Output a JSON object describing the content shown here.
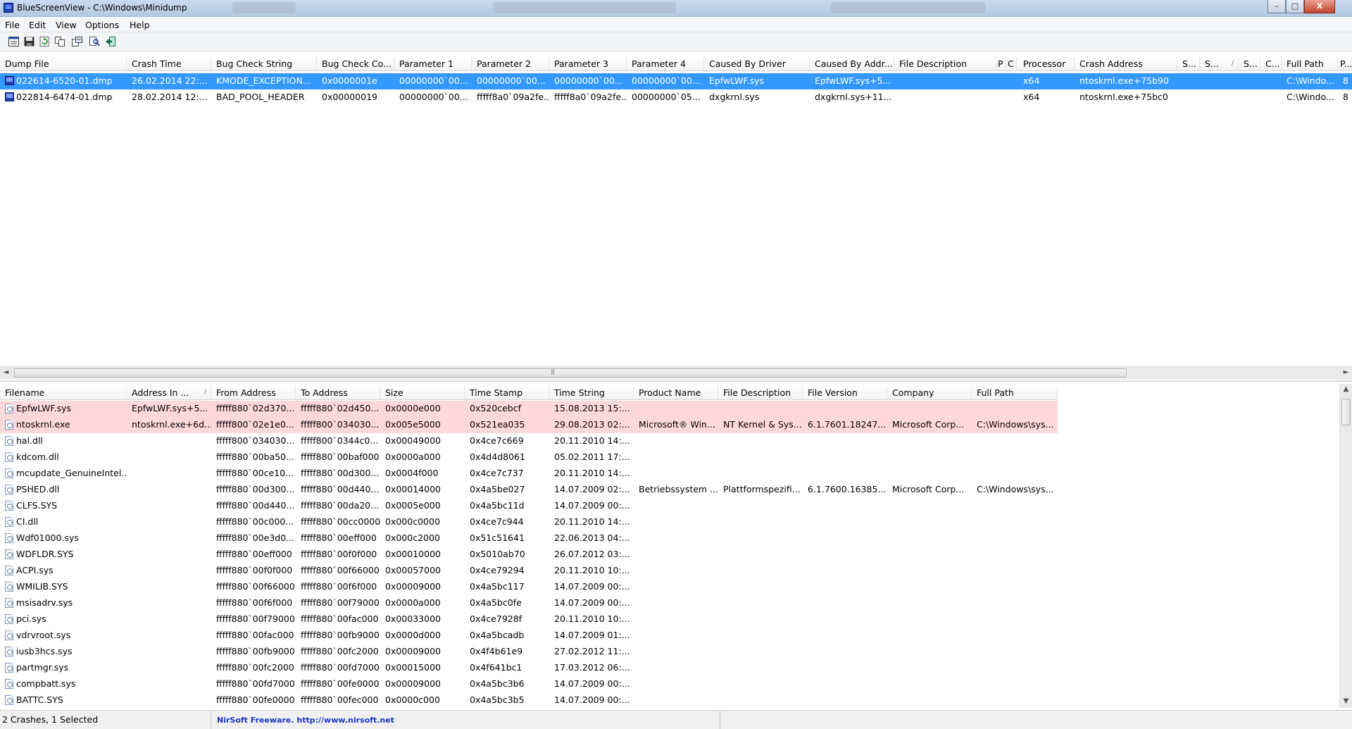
{
  "window": {
    "title": "BlueScreenView  -  C:\\Windows\\Minidump",
    "minimize": "–",
    "maximize": "□",
    "close": "X"
  },
  "menu": [
    "File",
    "Edit",
    "View",
    "Options",
    "Help"
  ],
  "toolbar": {
    "icons": [
      "properties-icon",
      "save-icon",
      "refresh-icon",
      "copy-icon",
      "advanced-options-icon",
      "find-icon",
      "exit-icon"
    ]
  },
  "crashes": {
    "columns": [
      "Dump File",
      "Crash Time",
      "Bug Check String",
      "Bug Check Co...",
      "Parameter 1",
      "Parameter 2",
      "Parameter 3",
      "Parameter 4",
      "Caused By Driver",
      "Caused By Addr...",
      "File Description",
      "P",
      "C",
      "Processor",
      "Crash Address",
      "S...",
      "S...",
      "S...",
      "C...",
      "Full Path",
      "P..."
    ],
    "rows": [
      {
        "selected": true,
        "cells": [
          "022614-6520-01.dmp",
          "26.02.2014 22:...",
          "KMODE_EXCEPTION...",
          "0x0000001e",
          "00000000`00...",
          "00000000`00...",
          "00000000`00...",
          "00000000`00...",
          "EpfwLWF.sys",
          "EpfwLWF.sys+5...",
          "",
          "",
          "",
          "x64",
          "ntoskrnl.exe+75b90",
          "",
          "",
          "",
          "",
          "C:\\Windo...",
          "8"
        ]
      },
      {
        "selected": false,
        "cells": [
          "022814-6474-01.dmp",
          "28.02.2014 12:...",
          "BAD_POOL_HEADER",
          "0x00000019",
          "00000000`00...",
          "fffff8a0`09a2fe...",
          "fffff8a0`09a2fe...",
          "00000000`05...",
          "dxgkrnl.sys",
          "dxgkrnl.sys+11...",
          "",
          "",
          "",
          "x64",
          "ntoskrnl.exe+75bc0",
          "",
          "",
          "",
          "",
          "C:\\Windo...",
          "8"
        ]
      }
    ]
  },
  "modules": {
    "columns": [
      "Filename",
      "Address In ...",
      "From Address",
      "To Address",
      "Size",
      "Time Stamp",
      "Time String",
      "Product Name",
      "File Description",
      "File Version",
      "Company",
      "Full Path"
    ],
    "sort_glyph": "/",
    "rows": [
      {
        "pink": true,
        "cells": [
          "EpfwLWF.sys",
          "EpfwLWF.sys+5...",
          "fffff880`02d370...",
          "fffff880`02d450...",
          "0x0000e000",
          "0x520cebcf",
          "15.08.2013 15:...",
          "",
          "",
          "",
          "",
          ""
        ]
      },
      {
        "pink": true,
        "cells": [
          "ntoskrnl.exe",
          "ntoskrnl.exe+6d...",
          "fffff800`02e1e0...",
          "fffff800`034030...",
          "0x005e5000",
          "0x521ea035",
          "29.08.2013 02:...",
          "Microsoft® Win...",
          "NT Kernel & Sys...",
          "6.1.7601.18247...",
          "Microsoft Corp...",
          "C:\\Windows\\sys..."
        ]
      },
      {
        "pink": false,
        "cells": [
          "hal.dll",
          "",
          "fffff800`034030...",
          "fffff800`0344c0...",
          "0x00049000",
          "0x4ce7c669",
          "20.11.2010 14:...",
          "",
          "",
          "",
          "",
          ""
        ]
      },
      {
        "pink": false,
        "cells": [
          "kdcom.dll",
          "",
          "fffff880`00ba50...",
          "fffff880`00baf000",
          "0x0000a000",
          "0x4d4d8061",
          "05.02.2011 17:...",
          "",
          "",
          "",
          "",
          ""
        ]
      },
      {
        "pink": false,
        "cells": [
          "mcupdate_GenuineIntel...",
          "",
          "fffff880`00ce10...",
          "fffff880`00d300...",
          "0x0004f000",
          "0x4ce7c737",
          "20.11.2010 14:...",
          "",
          "",
          "",
          "",
          ""
        ]
      },
      {
        "pink": false,
        "cells": [
          "PSHED.dll",
          "",
          "fffff880`00d300...",
          "fffff880`00d440...",
          "0x00014000",
          "0x4a5be027",
          "14.07.2009 02:...",
          "Betriebssystem ...",
          "Plattformspezifi...",
          "6.1.7600.16385...",
          "Microsoft Corp...",
          "C:\\Windows\\sys..."
        ]
      },
      {
        "pink": false,
        "cells": [
          "CLFS.SYS",
          "",
          "fffff880`00d440...",
          "fffff880`00da20...",
          "0x0005e000",
          "0x4a5bc11d",
          "14.07.2009 00:...",
          "",
          "",
          "",
          "",
          ""
        ]
      },
      {
        "pink": false,
        "cells": [
          "CI.dll",
          "",
          "fffff880`00c000...",
          "fffff880`00cc0000",
          "0x000c0000",
          "0x4ce7c944",
          "20.11.2010 14:...",
          "",
          "",
          "",
          "",
          ""
        ]
      },
      {
        "pink": false,
        "cells": [
          "Wdf01000.sys",
          "",
          "fffff880`00e3d0...",
          "fffff880`00eff000",
          "0x000c2000",
          "0x51c51641",
          "22.06.2013 04:...",
          "",
          "",
          "",
          "",
          ""
        ]
      },
      {
        "pink": false,
        "cells": [
          "WDFLDR.SYS",
          "",
          "fffff880`00eff000",
          "fffff880`00f0f000",
          "0x00010000",
          "0x5010ab70",
          "26.07.2012 03:...",
          "",
          "",
          "",
          "",
          ""
        ]
      },
      {
        "pink": false,
        "cells": [
          "ACPI.sys",
          "",
          "fffff880`00f0f000",
          "fffff880`00f66000",
          "0x00057000",
          "0x4ce79294",
          "20.11.2010 10:...",
          "",
          "",
          "",
          "",
          ""
        ]
      },
      {
        "pink": false,
        "cells": [
          "WMILIB.SYS",
          "",
          "fffff880`00f66000",
          "fffff880`00f6f000",
          "0x00009000",
          "0x4a5bc117",
          "14.07.2009 00:...",
          "",
          "",
          "",
          "",
          ""
        ]
      },
      {
        "pink": false,
        "cells": [
          "msisadrv.sys",
          "",
          "fffff880`00f6f000",
          "fffff880`00f79000",
          "0x0000a000",
          "0x4a5bc0fe",
          "14.07.2009 00:...",
          "",
          "",
          "",
          "",
          ""
        ]
      },
      {
        "pink": false,
        "cells": [
          "pci.sys",
          "",
          "fffff880`00f79000",
          "fffff880`00fac000",
          "0x00033000",
          "0x4ce7928f",
          "20.11.2010 10:...",
          "",
          "",
          "",
          "",
          ""
        ]
      },
      {
        "pink": false,
        "cells": [
          "vdrvroot.sys",
          "",
          "fffff880`00fac000",
          "fffff880`00fb9000",
          "0x0000d000",
          "0x4a5bcadb",
          "14.07.2009 01:...",
          "",
          "",
          "",
          "",
          ""
        ]
      },
      {
        "pink": false,
        "cells": [
          "iusb3hcs.sys",
          "",
          "fffff880`00fb9000",
          "fffff880`00fc2000",
          "0x00009000",
          "0x4f4b61e9",
          "27.02.2012 11:...",
          "",
          "",
          "",
          "",
          ""
        ]
      },
      {
        "pink": false,
        "cells": [
          "partmgr.sys",
          "",
          "fffff880`00fc2000",
          "fffff880`00fd7000",
          "0x00015000",
          "0x4f641bc1",
          "17.03.2012 06:...",
          "",
          "",
          "",
          "",
          ""
        ]
      },
      {
        "pink": false,
        "cells": [
          "compbatt.sys",
          "",
          "fffff880`00fd7000",
          "fffff880`00fe0000",
          "0x00009000",
          "0x4a5bc3b6",
          "14.07.2009 00:...",
          "",
          "",
          "",
          "",
          ""
        ]
      },
      {
        "pink": false,
        "cells": [
          "BATTC.SYS",
          "",
          "fffff880`00fe0000",
          "fffff880`00fec000",
          "0x0000c000",
          "0x4a5bc3b5",
          "14.07.2009 00:...",
          "",
          "",
          "",
          "",
          ""
        ]
      }
    ]
  },
  "statusbar": {
    "count": "2 Crashes, 1 Selected",
    "link": "NirSoft Freeware.  http://www.nirsoft.net"
  },
  "colors": {
    "selection": "#3399ff",
    "faulting_driver_highlight": "#ffd9da",
    "link": "#1a34c7"
  }
}
